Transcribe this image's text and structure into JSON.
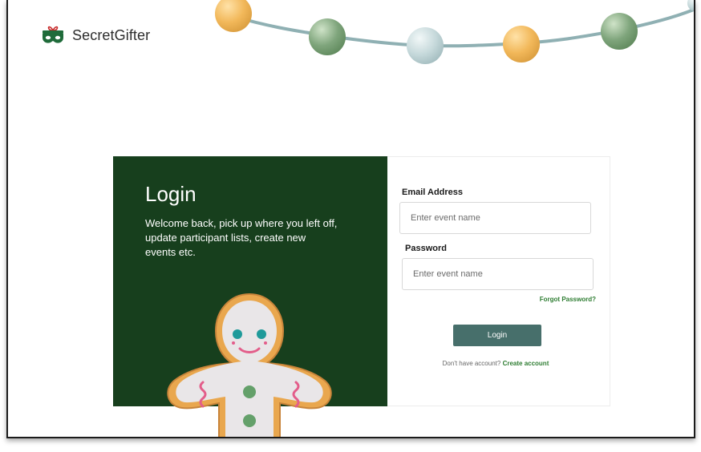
{
  "brand": {
    "name": "SecretGifter",
    "icon": "gift-mask-icon"
  },
  "decorations": {
    "light_colors": [
      "#f2b85a",
      "#7fa57c",
      "#c6d9db",
      "#f2b85a",
      "#7fa57c"
    ]
  },
  "login_panel": {
    "title": "Login",
    "subtitle": "Welcome back, pick up where you left off, update participant lists, create new events etc."
  },
  "form": {
    "email": {
      "label": "Email Address",
      "placeholder": "Enter event name",
      "value": ""
    },
    "password": {
      "label": "Password",
      "placeholder": "Enter event name",
      "value": ""
    },
    "forgot_password": "Forgot Password?",
    "submit_label": "Login",
    "signup_prompt": "Don't have account?",
    "signup_link": "Create account"
  },
  "colors": {
    "panel_green": "#173f1d",
    "button": "#476f6b",
    "link_green": "#2e7d32"
  }
}
